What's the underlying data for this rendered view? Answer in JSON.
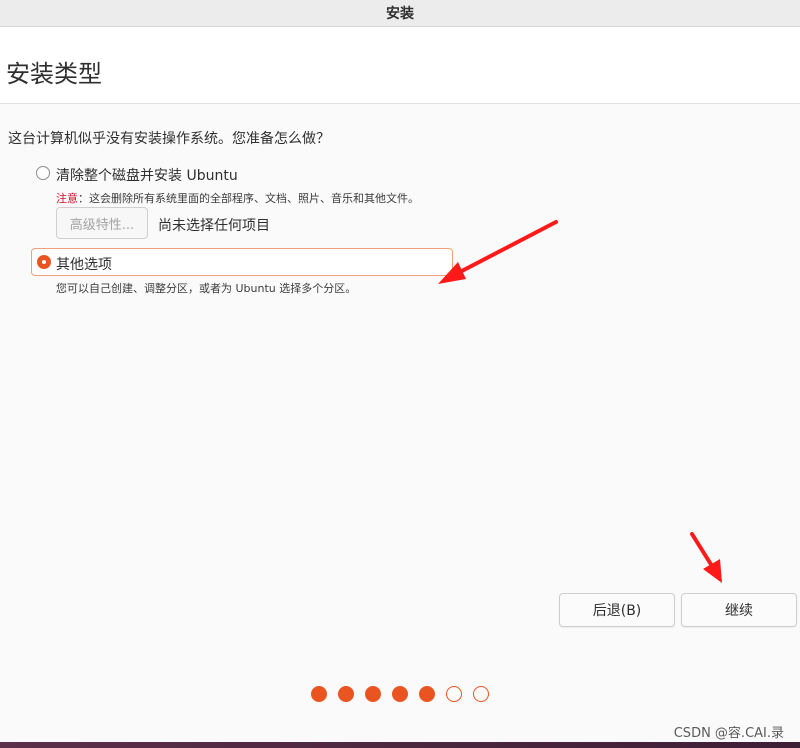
{
  "window": {
    "title": "安装"
  },
  "header": {
    "title": "安装类型"
  },
  "question": "这台计算机似乎没有安装操作系统。您准备怎么做？",
  "options": [
    {
      "label": "清除整个磁盘并安装 Ubuntu",
      "selected": false,
      "note_prefix": "注意",
      "note_text": "：这会删除所有系统里面的全部程序、文档、照片、音乐和其他文件。",
      "advanced_button": "高级特性...",
      "advanced_status": "尚未选择任何项目"
    },
    {
      "label": "其他选项",
      "selected": true,
      "description": "您可以自己创建、调整分区，或者为 Ubuntu 选择多个分区。"
    }
  ],
  "buttons": {
    "back": "后退(B)",
    "continue": "继续"
  },
  "progress": {
    "total": 7,
    "completed": 5
  },
  "watermark": "CSDN @容.CAI.录",
  "colors": {
    "accent": "#e95420",
    "warning": "#c7162b",
    "annotation_arrow": "#ff1a1a"
  },
  "annotation_icons": [
    "red-arrow-icon",
    "red-arrow-icon"
  ]
}
